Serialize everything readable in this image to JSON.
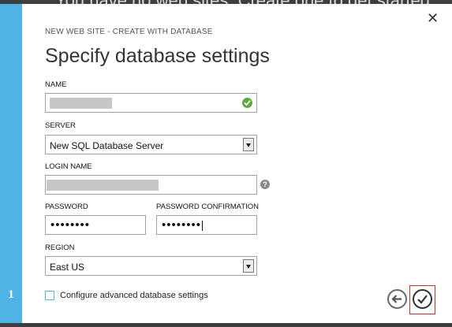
{
  "background_text": "You have no web sites. Create one to get started",
  "step": {
    "number": "1"
  },
  "dialog": {
    "kicker": "NEW WEB SITE - CREATE WITH DATABASE",
    "title": "Specify database settings",
    "close_glyph": "✕"
  },
  "fields": {
    "name": {
      "label": "NAME",
      "value_masked": true,
      "valid": true
    },
    "server": {
      "label": "SERVER",
      "value": "New SQL Database Server"
    },
    "login_name": {
      "label": "LOGIN NAME",
      "value_masked": true,
      "help_glyph": "?"
    },
    "password": {
      "label": "PASSWORD",
      "value": "••••••••"
    },
    "password_confirmation": {
      "label": "PASSWORD CONFIRMATION",
      "value": "••••••••"
    },
    "region": {
      "label": "REGION",
      "value": "East US"
    }
  },
  "advanced": {
    "label": "Configure advanced database settings",
    "checked": false
  },
  "nav": {
    "back_icon": "arrow-left-icon",
    "confirm_icon": "checkmark-icon"
  },
  "colors": {
    "accent": "#4fb3e3",
    "valid": "#5fa83f",
    "focus_frame": "#c53030"
  }
}
